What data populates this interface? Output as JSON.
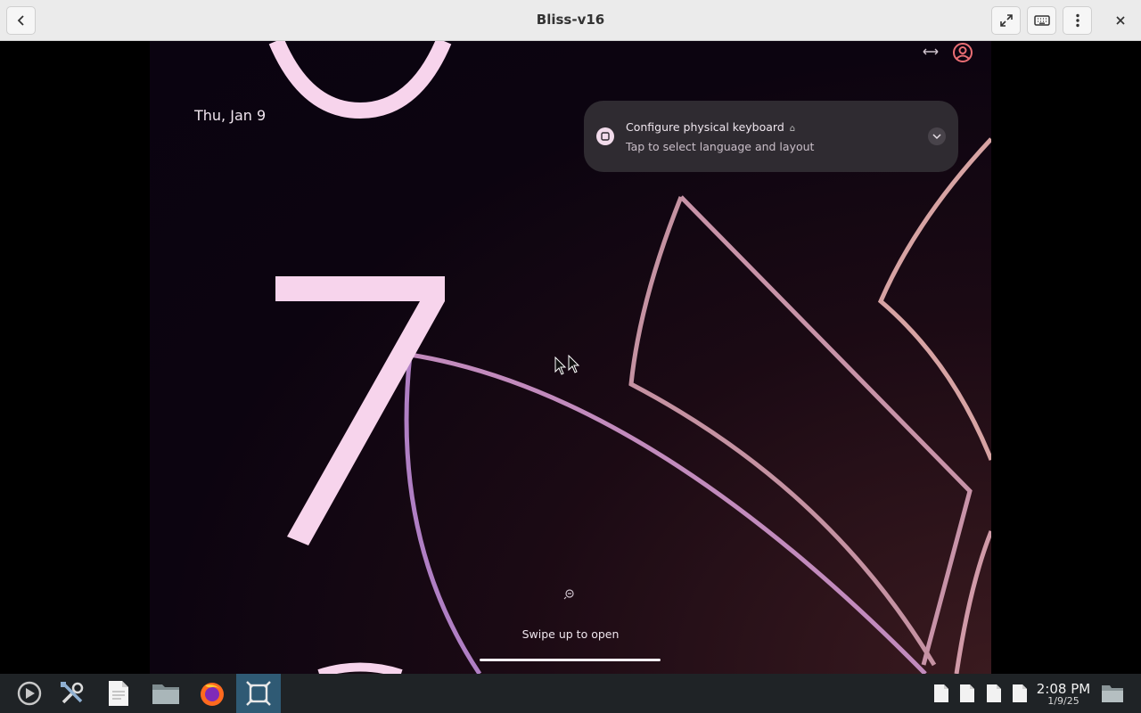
{
  "window": {
    "title": "Bliss-v16",
    "back_icon": "chevron-left-icon",
    "fullscreen_icon": "fullscreen-icon",
    "keyboard_icon": "keyboard-icon",
    "menu_icon": "kebab-menu-icon",
    "close_icon": "close-icon"
  },
  "lockscreen": {
    "date": "Thu, Jan 9",
    "status_icons": [
      "swap-arrows-icon",
      "user-avatar-icon"
    ],
    "notification": {
      "app_icon": "keyboard-settings-icon",
      "title": "Configure physical keyboard",
      "title_icon": "bell-icon",
      "text": "Tap to select language and layout",
      "expand_icon": "chevron-down-icon"
    },
    "fingerprint_icon": "fingerprint-icon",
    "hint": "Swipe up to open",
    "accent_color": "#f7d4ec"
  },
  "taskbar": {
    "apps": [
      {
        "name": "app-launcher",
        "icon": "launcher-icon",
        "active": false
      },
      {
        "name": "settings",
        "icon": "tools-icon",
        "active": false
      },
      {
        "name": "text-editor",
        "icon": "document-icon",
        "active": false
      },
      {
        "name": "file-manager",
        "icon": "folder-icon",
        "active": false
      },
      {
        "name": "firefox",
        "icon": "firefox-icon",
        "active": false
      },
      {
        "name": "virtual-machine",
        "icon": "vm-icon",
        "active": true
      }
    ],
    "tray_docs": [
      "document-icon",
      "document-icon",
      "document-icon",
      "document-icon"
    ],
    "time": "2:08 PM",
    "date": "1/9/25",
    "files_icon": "folder-icon",
    "active_color": "#2f5a74"
  }
}
